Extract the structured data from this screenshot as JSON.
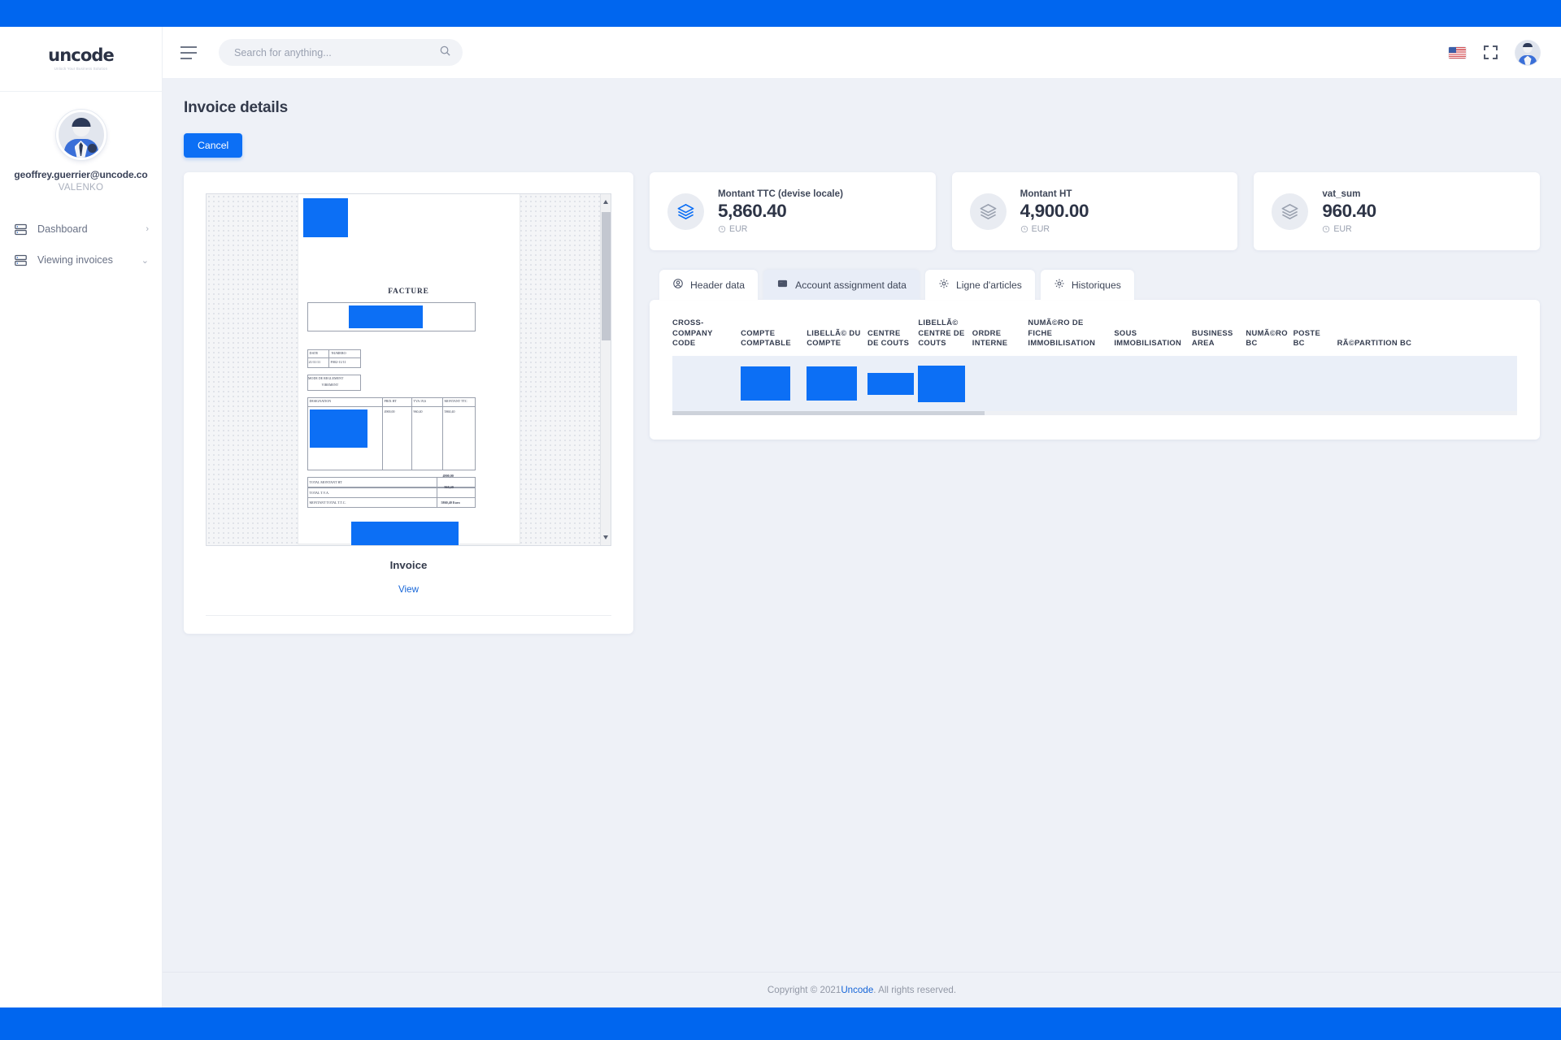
{
  "brand": {
    "logo": "uncode",
    "tagline": "Unlock Your Business Solution"
  },
  "sidebar": {
    "profile": {
      "email": "geoffrey.guerrier@uncode.co",
      "org": "VALENKO"
    },
    "items": [
      {
        "label": "Dashboard",
        "icon": "server-icon",
        "chevron": "›"
      },
      {
        "label": "Viewing invoices",
        "icon": "server-icon",
        "chevron": "⌄"
      }
    ]
  },
  "topbar": {
    "menu_icon": "hamburger-icon",
    "search_placeholder": "Search for anything...",
    "search_value": "",
    "search_icon": "search-icon",
    "flag_icon": "us-flag-icon",
    "fullscreen_icon": "fullscreen-icon",
    "avatar_icon": "user-avatar"
  },
  "page": {
    "title": "Invoice details",
    "cancel_label": "Cancel"
  },
  "document": {
    "name": "Invoice",
    "view_label": "View",
    "preview": {
      "title": "FACTURE",
      "meta_headers": [
        "DATE",
        "NUMERO"
      ],
      "meta_values": [
        "21/11/11",
        "F002-11/11"
      ],
      "payment_label": "MODE DE REGLEMENT",
      "payment_value": "VIREMENT",
      "line_headers": [
        "DESIGNATION",
        "PRIX HT",
        "TVA 19,6",
        "MONTANT TTC"
      ],
      "line_values": [
        "4900,00",
        "960,40",
        "5860,40"
      ],
      "totals": [
        {
          "label": "TOTAL MONTANT HT",
          "value": "4900,00"
        },
        {
          "label": "TOTAL  T.V.A.",
          "value": "960,40"
        },
        {
          "label": "MONTANT  TOTAL  T.T.C.",
          "value": "5860,40 Euro"
        }
      ]
    }
  },
  "stats": [
    {
      "label": "Montant TTC (devise locale)",
      "value": "5,860.40",
      "currency": "EUR",
      "icon": "layers-icon",
      "accent": "#0c6ff5"
    },
    {
      "label": "Montant HT",
      "value": "4,900.00",
      "currency": "EUR",
      "icon": "layers-icon",
      "accent": "#9ba2b0"
    },
    {
      "label": "vat_sum",
      "value": "960.40",
      "currency": "EUR",
      "icon": "layers-icon",
      "accent": "#9ba2b0"
    }
  ],
  "tabs": [
    {
      "label": "Header data",
      "icon": "user-circle-icon",
      "active": false
    },
    {
      "label": "Account assignment data",
      "icon": "card-icon",
      "active": true
    },
    {
      "label": "Ligne d'articles",
      "icon": "gear-icon",
      "active": false
    },
    {
      "label": "Historiques",
      "icon": "gear-icon",
      "active": false
    }
  ],
  "table": {
    "columns": [
      "CROSS-COMPANY CODE",
      "COMPTE COMPTABLE",
      "LIBELLÃ© DU COMPTE",
      "CENTRE DE COUTS",
      "LIBELLÃ© CENTRE DE COUTS",
      "ORDRE INTERNE",
      "NUMÃ©RO DE FICHE IMMOBILISATION",
      "SOUS IMMOBILISATION",
      "BUSINESS AREA",
      "NUMÃ©RO BC",
      "POSTE BC",
      "RÃ©PARTITION BC"
    ],
    "rows": [
      [
        "",
        "redacted",
        "redacted",
        "redacted",
        "redacted",
        "",
        "",
        "",
        "",
        "",
        "",
        ""
      ]
    ]
  },
  "footer": {
    "prefix": "Copyright © 2021 ",
    "link": "Uncode",
    "suffix": ". All rights reserved."
  },
  "colors": {
    "brand_blue": "#0c6ff5",
    "band_blue": "#0066ef",
    "page_bg": "#eef1f7"
  }
}
